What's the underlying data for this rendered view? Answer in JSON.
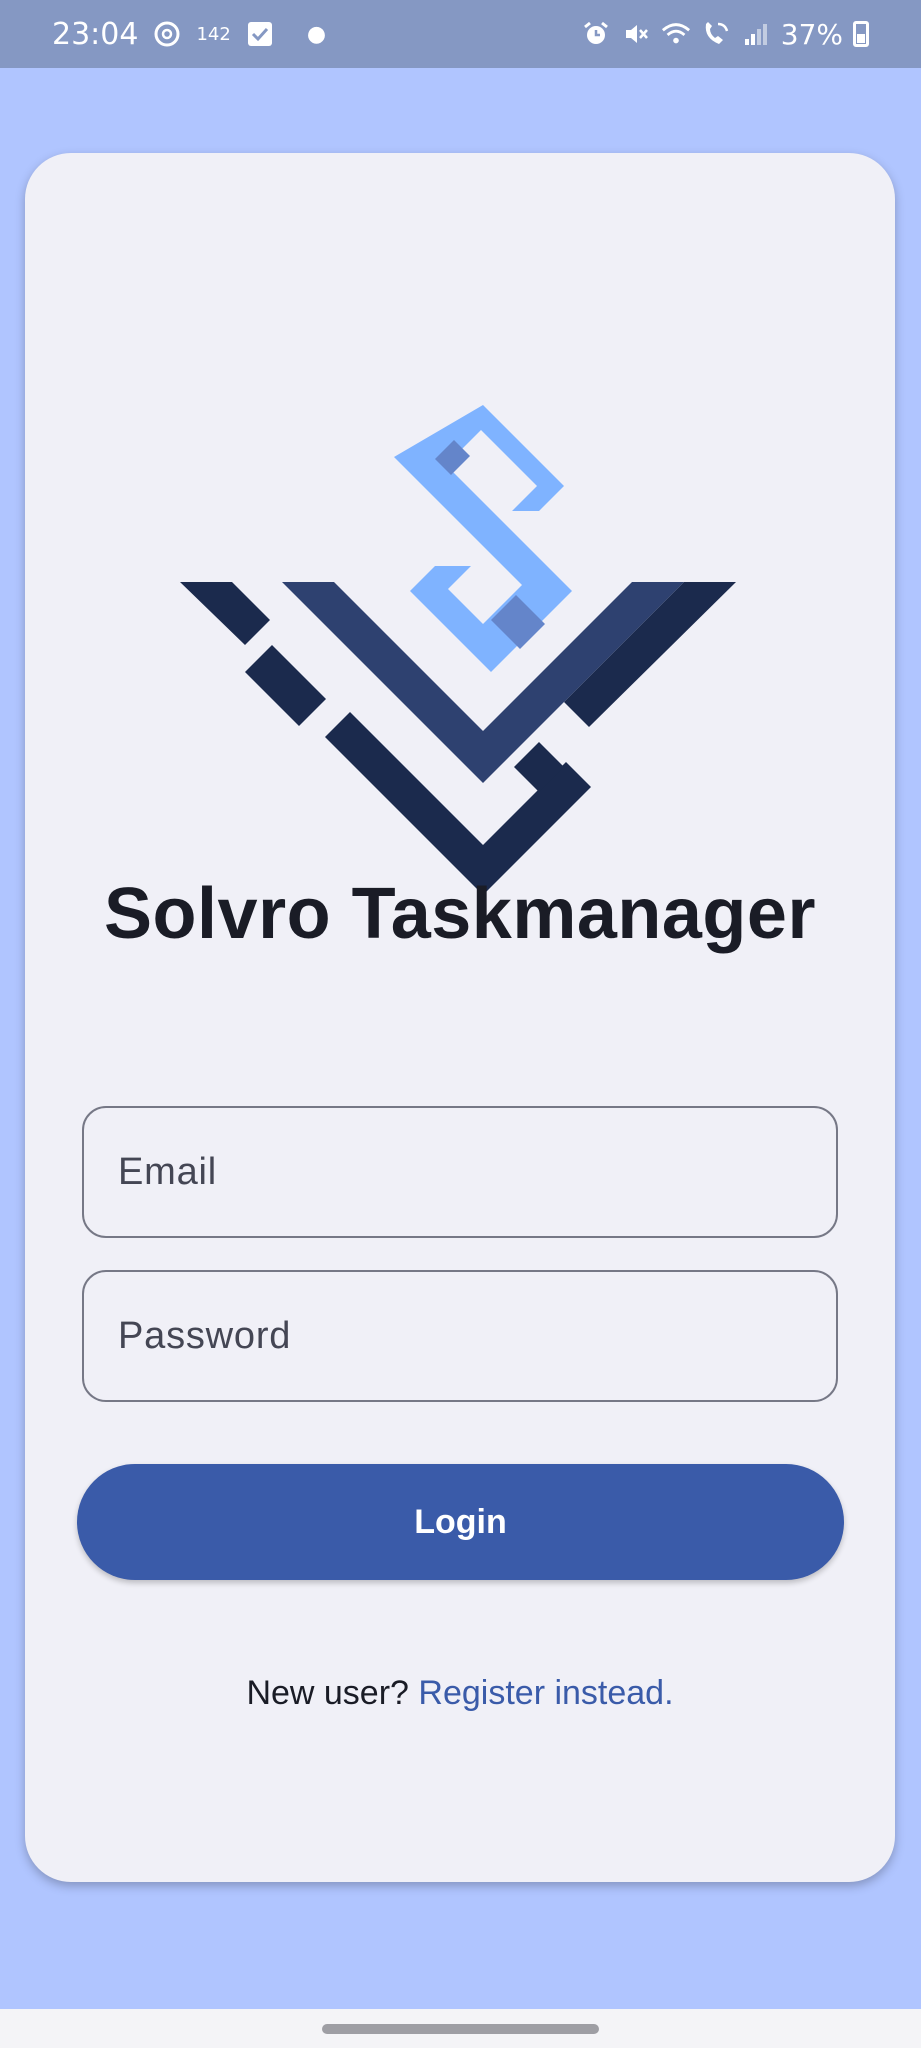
{
  "status_bar": {
    "time": "23:04",
    "notification_count": "142",
    "battery": "37%",
    "icons": [
      "threads-icon",
      "task-check-icon",
      "alarm-icon",
      "mute-icon",
      "wifi-icon",
      "wifi-call-icon",
      "signal-icon",
      "battery-icon"
    ]
  },
  "app": {
    "title": "Solvro Taskmanager",
    "logo": "solvro-logo"
  },
  "form": {
    "email_placeholder": "Email",
    "password_placeholder": "Password",
    "login_label": "Login",
    "register_prompt": "New user?",
    "register_link": "Register instead."
  },
  "colors": {
    "background": "#b0c5ff",
    "card": "#f0f0f7",
    "primary": "#3a5ba9",
    "logo_dark": "#1b2a4d",
    "logo_mid": "#2e4170",
    "logo_light": "#7fb3ff",
    "logo_accent": "#6485ca"
  }
}
